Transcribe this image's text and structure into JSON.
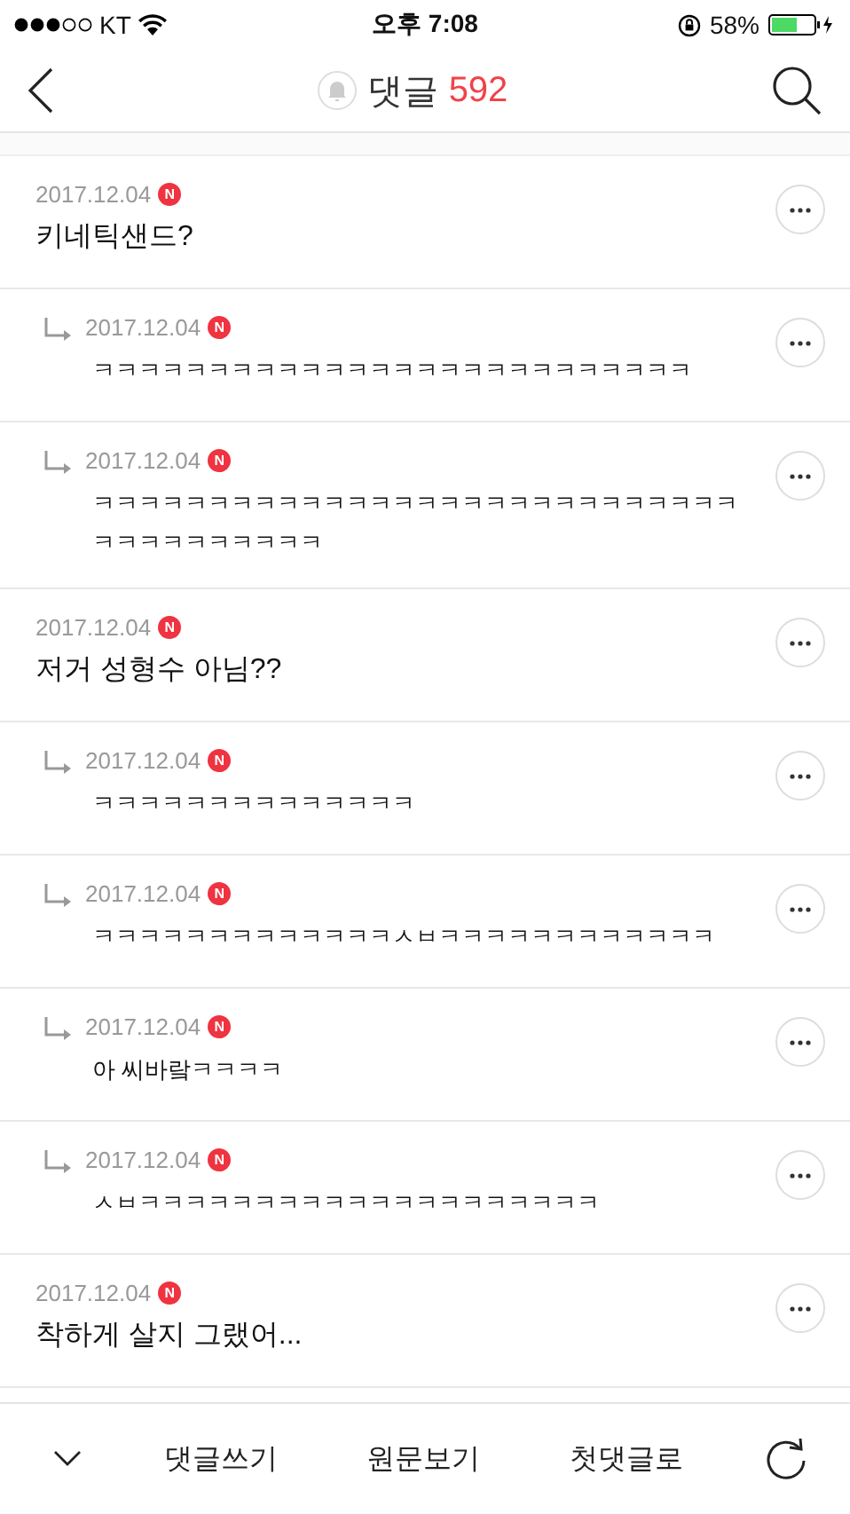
{
  "status_bar": {
    "carrier": "KT",
    "time": "오후 7:08",
    "battery": "58%"
  },
  "header": {
    "title": "댓글",
    "count": "592"
  },
  "comments": [
    {
      "kind": "comment",
      "date": "2017.12.04",
      "badge": "N",
      "text": "키네틱샌드?"
    },
    {
      "kind": "reply",
      "date": "2017.12.04",
      "badge": "N",
      "text": "ㅋㅋㅋㅋㅋㅋㅋㅋㅋㅋㅋㅋㅋㅋㅋㅋㅋㅋㅋㅋㅋㅋㅋㅋㅋㅋ"
    },
    {
      "kind": "reply",
      "date": "2017.12.04",
      "badge": "N",
      "text": "ㅋㅋㅋㅋㅋㅋㅋㅋㅋㅋㅋㅋㅋㅋㅋㅋㅋㅋㅋㅋㅋㅋㅋㅋㅋㅋㅋㅋㅋㅋㅋㅋㅋㅋㅋㅋㅋㅋ"
    },
    {
      "kind": "comment",
      "date": "2017.12.04",
      "badge": "N",
      "text": "저거 성형수 아님??"
    },
    {
      "kind": "reply",
      "date": "2017.12.04",
      "badge": "N",
      "text": "ㅋㅋㅋㅋㅋㅋㅋㅋㅋㅋㅋㅋㅋㅋ"
    },
    {
      "kind": "reply",
      "date": "2017.12.04",
      "badge": "N",
      "text": "ㅋㅋㅋㅋㅋㅋㅋㅋㅋㅋㅋㅋㅋㅅㅂㅋㅋㅋㅋㅋㅋㅋㅋㅋㅋㅋㅋ"
    },
    {
      "kind": "reply",
      "date": "2017.12.04",
      "badge": "N",
      "text": "아 씨바랔ㅋㅋㅋㅋ"
    },
    {
      "kind": "reply",
      "date": "2017.12.04",
      "badge": "N",
      "text": "ㅅㅂㅋㅋㅋㅋㅋㅋㅋㅋㅋㅋㅋㅋㅋㅋㅋㅋㅋㅋㅋㅋ"
    },
    {
      "kind": "comment",
      "date": "2017.12.04",
      "badge": "N",
      "text": "착하게 살지 그랬어..."
    }
  ],
  "toolbar": [
    "댓글쓰기",
    "원문보기",
    "첫댓글로"
  ]
}
